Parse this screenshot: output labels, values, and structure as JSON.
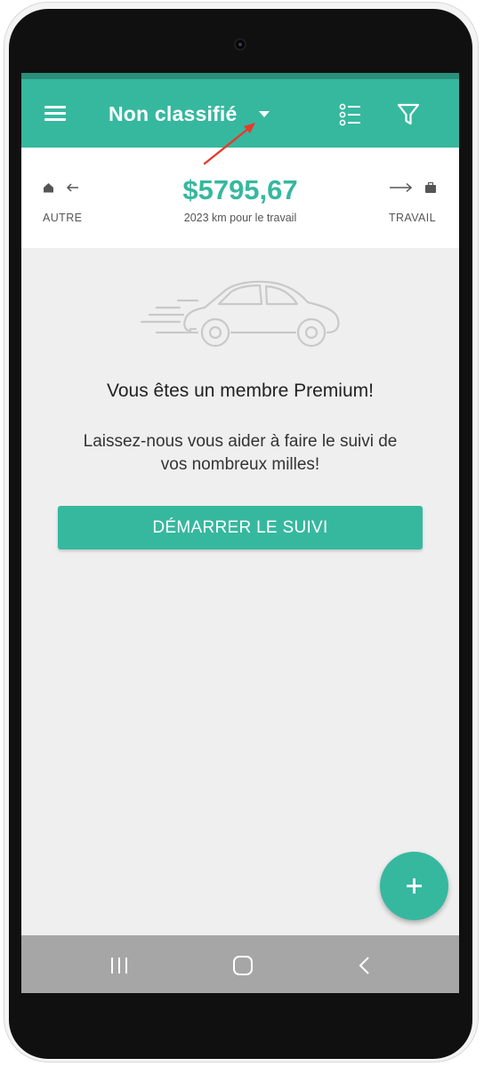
{
  "appbar": {
    "title": "Non classifié",
    "icons": [
      "menu-icon",
      "dropdown-icon",
      "list-icon",
      "filter-icon"
    ]
  },
  "summary": {
    "amount": "$5795,67",
    "distance": "2023 km pour le travail",
    "left_label": "AUTRE",
    "right_label": "TRAVAIL"
  },
  "empty_state": {
    "heading": "Vous êtes un membre Premium!",
    "body": "Laissez-nous vous aider à faire le suivi de vos nombreux milles!",
    "button_label": "DÉMARRER LE SUIVI"
  },
  "colors": {
    "accent": "#36b89f",
    "status_strip": "#2a8f7b",
    "background": "#efefef",
    "navbar": "#a6a6a6",
    "annotation": "#e8392b"
  }
}
